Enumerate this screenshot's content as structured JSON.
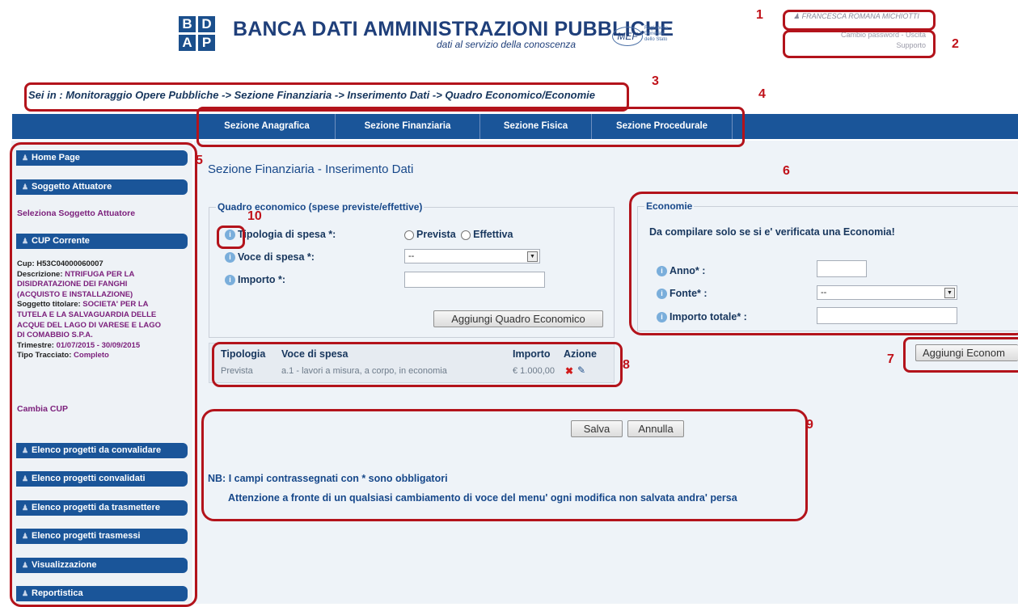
{
  "header": {
    "logo_letters": [
      "B",
      "D",
      "A",
      "P"
    ],
    "title": "BANCA DATI AMMINISTRAZIONI PUBBLICHE",
    "subtitle": "dati al servizio della conoscenza",
    "mef_logo": "MEF",
    "mef_caption": "Ragioneria Generale dello Stato",
    "user": "FRANCESCA ROMANA MICHIOTTI",
    "links_line": "Cambio password - Uscita",
    "support": "Supporto"
  },
  "breadcrumb": "Sei in : Monitoraggio Opere Pubbliche -> Sezione Finanziaria -> Inserimento Dati -> Quadro Economico/Economie",
  "nav_tabs": [
    "Sezione Anagrafica",
    "Sezione Finanziaria",
    "Sezione Fisica",
    "Sezione Procedurale"
  ],
  "sidebar": {
    "home": "Home Page",
    "soggetto_head": "Soggetto Attuatore",
    "soggetto_link": "Seleziona Soggetto Attuatore",
    "cup_head": "CUP Corrente",
    "cup_label": "Cup:",
    "cup_value": "H53C04000060007",
    "descr_label": "Descrizione:",
    "descr_value_1": "NTRIFUGA PER LA",
    "descr_value_2": "DISIDRATAZIONE DEI FANGHI",
    "descr_value_3": "(ACQUISTO E INSTALLAZIONE)",
    "titolare_label": "Soggetto titolare:",
    "titolare_value_1": "SOCIETA' PER LA",
    "titolare_value_2": "TUTELA E LA SALVAGUARDIA DELLE",
    "titolare_value_3": "ACQUE DEL LAGO DI VARESE E LAGO",
    "titolare_value_4": "DI COMABBIO S.P.A.",
    "trimestre_label": "Trimestre:",
    "trimestre_value": "01/07/2015 - 30/09/2015",
    "tracciato_label": "Tipo Tracciato:",
    "tracciato_value": "Completo",
    "cambia_cup": "Cambia CUP",
    "menu": [
      "Elenco progetti da convalidare",
      "Elenco progetti convalidati",
      "Elenco progetti da trasmettere",
      "Elenco progetti trasmessi",
      "Visualizzazione",
      "Reportistica"
    ]
  },
  "main": {
    "title": "Sezione Finanziaria - Inserimento Dati",
    "quadro": {
      "legend": "Quadro economico (spese previste/effettive)",
      "tipologia_label": "Tipologia di spesa *:",
      "opt_prevista": "Prevista",
      "opt_effettiva": "Effettiva",
      "voce_label": "Voce di spesa *:",
      "voce_value": "--",
      "importo_label": "Importo *:",
      "add_button": "Aggiungi Quadro Economico"
    },
    "table": {
      "headers": [
        "Tipologia",
        "Voce di spesa",
        "Importo",
        "Azione"
      ],
      "row": [
        "Prevista",
        "a.1 - lavori a misura, a corpo, in economia",
        "€ 1.000,00"
      ]
    },
    "economie": {
      "legend": "Economie",
      "note": "Da compilare solo se si e' verificata una Economia!",
      "anno_label": "Anno* :",
      "fonte_label": "Fonte* :",
      "fonte_value": "--",
      "importo_label": "Importo totale* :",
      "add_button": "Aggiungi Econom"
    },
    "save": "Salva",
    "cancel": "Annulla",
    "nb": "NB: I campi contrassegnati con * sono obbligatori",
    "warning": "Attenzione a fronte di un qualsiasi cambiamento di voce del menu' ogni modifica non salvata andra' persa"
  },
  "callout_numbers": [
    "1",
    "2",
    "3",
    "4",
    "5",
    "6",
    "7",
    "8",
    "9",
    "10"
  ]
}
